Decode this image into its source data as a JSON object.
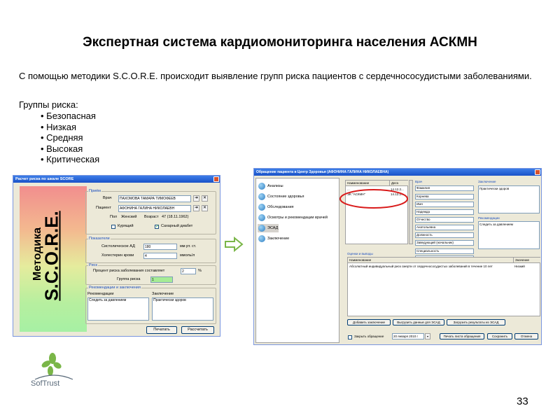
{
  "slide": {
    "title": "Экспертная система кардиомониторинга населения АСКМН",
    "description": "С помощью методики S.C.O.R.E. происходит выявление групп риска пациентов с сердечнососудистыми заболеваниями.",
    "groups_title": "Группы риска:",
    "groups": [
      "Безопасная",
      "Низкая",
      "Средняя",
      "Высокая",
      "Критическая"
    ],
    "page_number": "33"
  },
  "score_window": {
    "title": "Расчет риска по шкале SCORE",
    "side_label_top": "Методика",
    "side_label_main": "S.C.O.R.E.",
    "reception": {
      "legend": "Приём",
      "doctor_label": "Врач",
      "doctor_value": "ПАХОМОВА ТАМАРА ТИМОФЕЕВ",
      "patient_label": "Пациент",
      "patient_value": "АФОНИНА ГАЛИНА НИКОЛАЕВН",
      "sex_label": "Пол",
      "sex_value": "Женский",
      "age_label": "Возраст",
      "age_value": "47 (18.11.1962)",
      "smoker_label": "Курящий",
      "diabetes_label": "Сахарный диабет"
    },
    "indicators": {
      "legend": "Показатели",
      "systolic_label": "Систолическое АД",
      "systolic_value": "180",
      "systolic_unit": "мм рт. ст.",
      "cholesterol_label": "Холестерин крови",
      "cholesterol_value": "4",
      "cholesterol_unit": "ммоль/л"
    },
    "risk": {
      "legend": "Риск",
      "percent_label": "Процент риска заболевания составляет",
      "percent_value": "2",
      "percent_unit": "%",
      "group_label": "Группа риска",
      "group_value": "1"
    },
    "recommendations": {
      "legend": "Рекомендации и заключения",
      "rec_label": "Рекомендации",
      "rec_value": "Следить за давлением",
      "conclusion_label": "Заключение",
      "conclusion_value": "Практически здоров"
    },
    "print_button": "Печатать",
    "calc_button": "Рассчитать"
  },
  "arrow_symbol": "⇨",
  "health_window": {
    "title": "Обращение пациента в Центр Здоровья (АФОНИНА ГАЛИНА НИКОЛАЕВНА)",
    "nav": [
      "Анализы",
      "Состояние здоровья",
      "Обследования",
      "Осмотры и рекомендации врачей",
      "ЭСАД",
      "Заключение"
    ],
    "table": {
      "col_name": "Наименование",
      "col_date": "Дата",
      "rows": [
        {
          "name": "...",
          "date": "14.12.2..."
        },
        {
          "name": "ЭК \"АСКМН\"",
          "date": "14.12.2..."
        }
      ]
    },
    "doctor_panel": {
      "legend": "Врач",
      "fields": [
        "Фамилия",
        "Имя",
        "Отчество",
        "Должность",
        "Заведующий (начальник)",
        "Специальность",
        "Терапия"
      ],
      "values": [
        "",
        "Корнева",
        "Надежда",
        "Анатольевна",
        "",
        "",
        ""
      ]
    },
    "conclusion_panel": {
      "legend": "Заключение",
      "value": "Практически здоров",
      "rec_legend": "Рекомендации",
      "rec_value": "Следить за давлением"
    },
    "results": {
      "legend": "Оценки и выводы",
      "col_name": "Наименование",
      "col_value": "Значение",
      "row_name": "Абсолютный индивидуальный риск смерти от сердечнососудистых заболеваний в течение 10 лет",
      "row_value": "Низкий"
    },
    "buttons": {
      "add_conclusion": "Добавить заключение",
      "upload_data": "Выгрузить данные для ЭСАД",
      "load_results": "Загрузить результаты из ЭСАД",
      "close_visit_label": "Закрыть обращение",
      "date_day": "20",
      "date_month": "января",
      "date_year": "2010 г",
      "print_sheet": "Печать листа обращения",
      "save": "Сохранить",
      "cancel": "Отмена"
    }
  },
  "logo": {
    "text": "SofTrust"
  }
}
